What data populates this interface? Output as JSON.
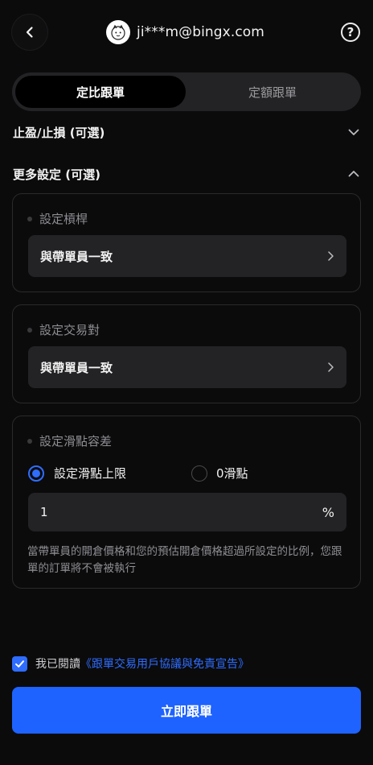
{
  "header": {
    "user_email": "ji***m@bingx.com",
    "back_icon": "chevron-left-icon",
    "help_icon": "question-circle-icon",
    "help_glyph": "?"
  },
  "tabs": [
    {
      "label": "定比跟單",
      "active": true
    },
    {
      "label": "定額跟單",
      "active": false
    }
  ],
  "sections": {
    "stop_profit_loss": {
      "title": "止盈/止損 (可選)",
      "expanded": false
    },
    "more_settings": {
      "title": "更多設定 (可選)",
      "expanded": true
    }
  },
  "leverage": {
    "label": "設定槓桿",
    "value": "與帶單員一致"
  },
  "trading_pair": {
    "label": "設定交易對",
    "value": "與帶單員一致"
  },
  "slippage": {
    "label": "設定滑點容差",
    "option_limit": "設定滑點上限",
    "option_zero": "0滑點",
    "selected": "option_limit",
    "input_value": "1",
    "unit": "%",
    "note": "當帶單員的開倉價格和您的預估開倉價格超過所設定的比例，您跟單的訂單將不會被執行"
  },
  "agreement": {
    "checked": true,
    "prefix": "我已閱讀",
    "link": "《跟單交易用戶協議與免責宣告》"
  },
  "cta": {
    "label": "立即跟單"
  },
  "colors": {
    "accent": "#2f6dff",
    "cta": "#1e63ff",
    "background": "#0b0b0c",
    "surface": "#232325"
  }
}
